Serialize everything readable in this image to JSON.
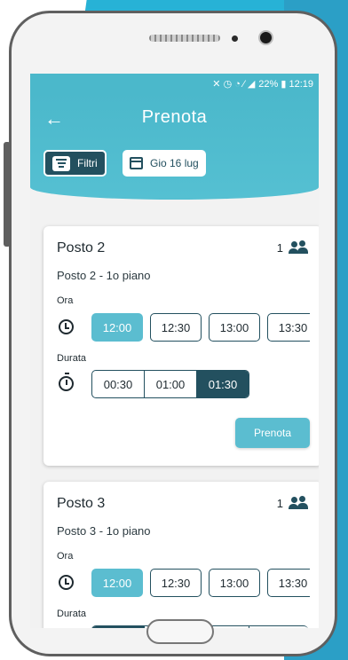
{
  "status": {
    "text": "22% ▮ 12:19",
    "icons": "✕ ◷ ◔ ⁄ ◢"
  },
  "header": {
    "title": "Prenota",
    "back_icon": "←"
  },
  "filters": {
    "filter_label": "Filtri",
    "date_label": "Gio 16 lug"
  },
  "time_label": "Ora",
  "duration_label": "Durata",
  "cards": [
    {
      "title": "Posto 2",
      "capacity": "1",
      "subtitle": "Posto 2 - 1o piano",
      "times": [
        "12:00",
        "12:30",
        "13:00",
        "13:30"
      ],
      "selected_time": "12:00",
      "durations": [
        "00:30",
        "01:00",
        "01:30"
      ],
      "selected_duration": "01:30",
      "book_label": "Prenota"
    },
    {
      "title": "Posto 3",
      "capacity": "1",
      "subtitle": "Posto 3 - 1o piano",
      "times": [
        "12:00",
        "12:30",
        "13:00",
        "13:30"
      ],
      "selected_time": "12:00"
    }
  ],
  "colors": {
    "header": "#4bb8cb",
    "primary_dark": "#23505f",
    "selected": "#5bbdd0"
  }
}
